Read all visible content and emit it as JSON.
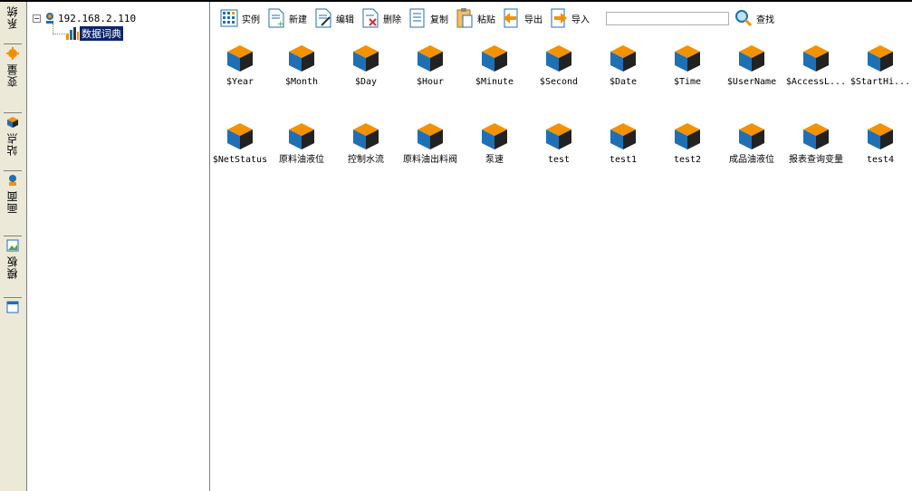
{
  "tabs": [
    {
      "label": "系统",
      "icon": "system-icon"
    },
    {
      "label": "变量",
      "icon": "gear-icon"
    },
    {
      "label": "站点",
      "icon": "cube-icon"
    },
    {
      "label": "画面",
      "icon": "station-icon"
    },
    {
      "label": "模板",
      "icon": "picture-icon"
    }
  ],
  "tree": {
    "root": "192.168.2.110",
    "child": "数据词典"
  },
  "toolbar": {
    "instance": "实例",
    "new": "新建",
    "edit": "编辑",
    "delete": "删除",
    "copy": "复制",
    "paste": "粘贴",
    "export": "导出",
    "import": "导入",
    "search_value": "",
    "find": "查找"
  },
  "variables": [
    "$Year",
    "$Month",
    "$Day",
    "$Hour",
    "$Minute",
    "$Second",
    "$Date",
    "$Time",
    "$UserName",
    "$AccessL...",
    "$StartHi...",
    "$NetStatus",
    "原料油液位",
    "控制水流",
    "原料油出料阀",
    "泵速",
    "test",
    "test1",
    "test2",
    "成品油液位",
    "报表查询变量",
    "test4"
  ],
  "colors": {
    "selection": "#0a246a",
    "cube_top": "#f39200",
    "cube_left": "#1f6fb5",
    "cube_right": "#222222"
  }
}
